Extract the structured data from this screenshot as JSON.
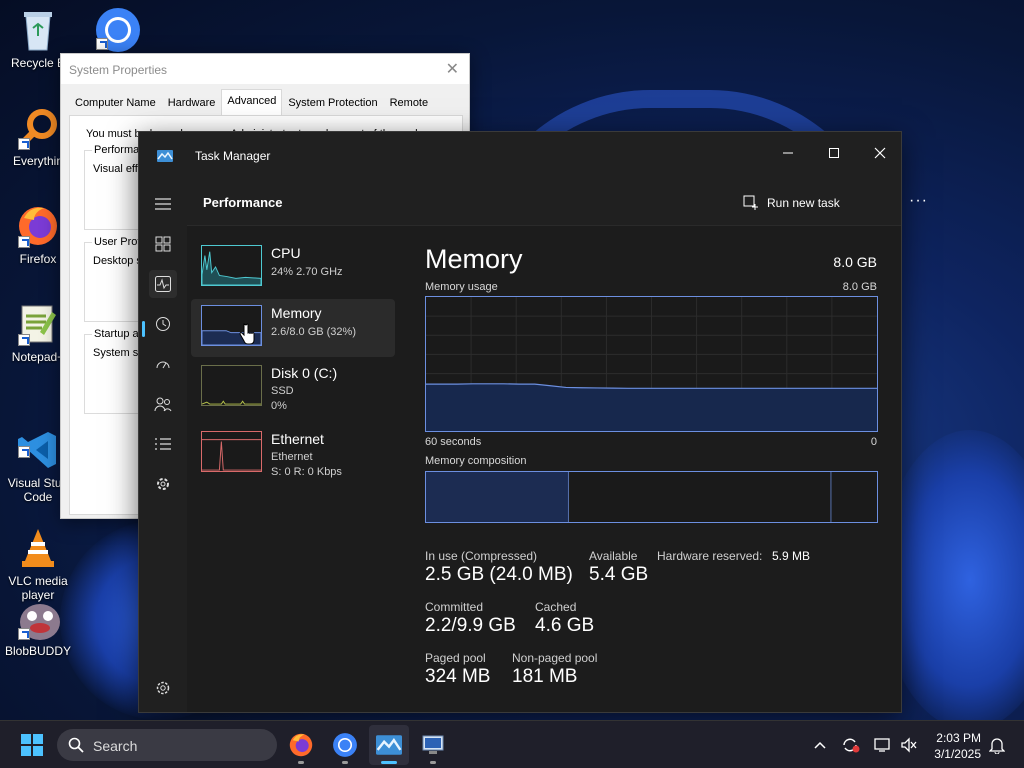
{
  "desktop": {
    "icons": [
      {
        "label": "Recycle B"
      },
      {
        "label": "Everythin"
      },
      {
        "label": "Firefox"
      },
      {
        "label": "Notepad+"
      },
      {
        "label": "Visual Stud\nCode"
      },
      {
        "label": "VLC media\nplayer"
      },
      {
        "label": "BlobBUDDY"
      }
    ]
  },
  "system_properties": {
    "title": "System Properties",
    "tabs": [
      "Computer Name",
      "Hardware",
      "Advanced",
      "System Protection",
      "Remote"
    ],
    "active_tab": "Advanced",
    "note": "You must be logged on as an Administrator to make most of these changes.",
    "groups": [
      {
        "label": "Performan",
        "sub": "Visual effe"
      },
      {
        "label": "User Profil",
        "sub": "Desktop s"
      },
      {
        "label": "Startup an",
        "sub": "System sta"
      }
    ]
  },
  "task_manager": {
    "title": "Task Manager",
    "page_title": "Performance",
    "run_new_task": "Run new task",
    "more": "···",
    "nav_icons": [
      "hamburger-icon",
      "processes-icon",
      "performance-icon",
      "app-history-icon",
      "startup-apps-icon",
      "users-icon",
      "details-icon",
      "services-icon",
      "settings-icon"
    ],
    "perf_items": [
      {
        "name": "CPU",
        "line1": "24% 2.70 GHz",
        "line2": "",
        "color": "#4ec9d1"
      },
      {
        "name": "Memory",
        "line1": "2.6/8.0 GB (32%)",
        "line2": "",
        "color": "#6c8fe0"
      },
      {
        "name": "Disk 0 (C:)",
        "line1": "SSD",
        "line2": "0%",
        "color": "#b7c34a"
      },
      {
        "name": "Ethernet",
        "line1": "Ethernet",
        "line2": "S: 0 R: 0 Kbps",
        "color": "#d96a6a"
      }
    ],
    "selected_item": "Memory",
    "memory": {
      "title": "Memory",
      "total": "8.0 GB",
      "usage_label": "Memory usage",
      "usage_max": "8.0 GB",
      "time_label": "60 seconds",
      "time_end": "0",
      "composition_label": "Memory composition",
      "usage_history_gb": [
        2.8,
        2.8,
        2.8,
        2.82,
        2.82,
        2.82,
        2.8,
        2.8,
        2.7,
        2.6,
        2.58,
        2.57,
        2.56,
        2.55,
        2.55,
        2.55,
        2.55,
        2.55,
        2.55,
        2.55,
        2.55,
        2.55,
        2.55,
        2.55,
        2.55,
        2.55,
        2.55,
        2.55,
        2.55,
        2.55
      ],
      "composition_gb": {
        "in_use": 2.5,
        "modified": 0.0,
        "standby": 4.6,
        "free": 0.8
      },
      "stats": {
        "in_use_label": "In use (Compressed)",
        "in_use_value": "2.5 GB (24.0 MB)",
        "available_label": "Available",
        "available_value": "5.4 GB",
        "hw_reserved_label": "Hardware reserved:",
        "hw_reserved_value": "5.9 MB",
        "committed_label": "Committed",
        "committed_value": "2.2/9.9 GB",
        "cached_label": "Cached",
        "cached_value": "4.6 GB",
        "paged_label": "Paged pool",
        "paged_value": "324 MB",
        "nonpaged_label": "Non-paged pool",
        "nonpaged_value": "181 MB"
      }
    }
  },
  "taskbar": {
    "search_label": "Search",
    "apps": [
      "firefox-icon",
      "chrome-icon",
      "task-manager-icon",
      "system-properties-icon"
    ],
    "active_app": "task-manager-icon",
    "time": "2:03 PM",
    "date": "3/1/2025"
  }
}
